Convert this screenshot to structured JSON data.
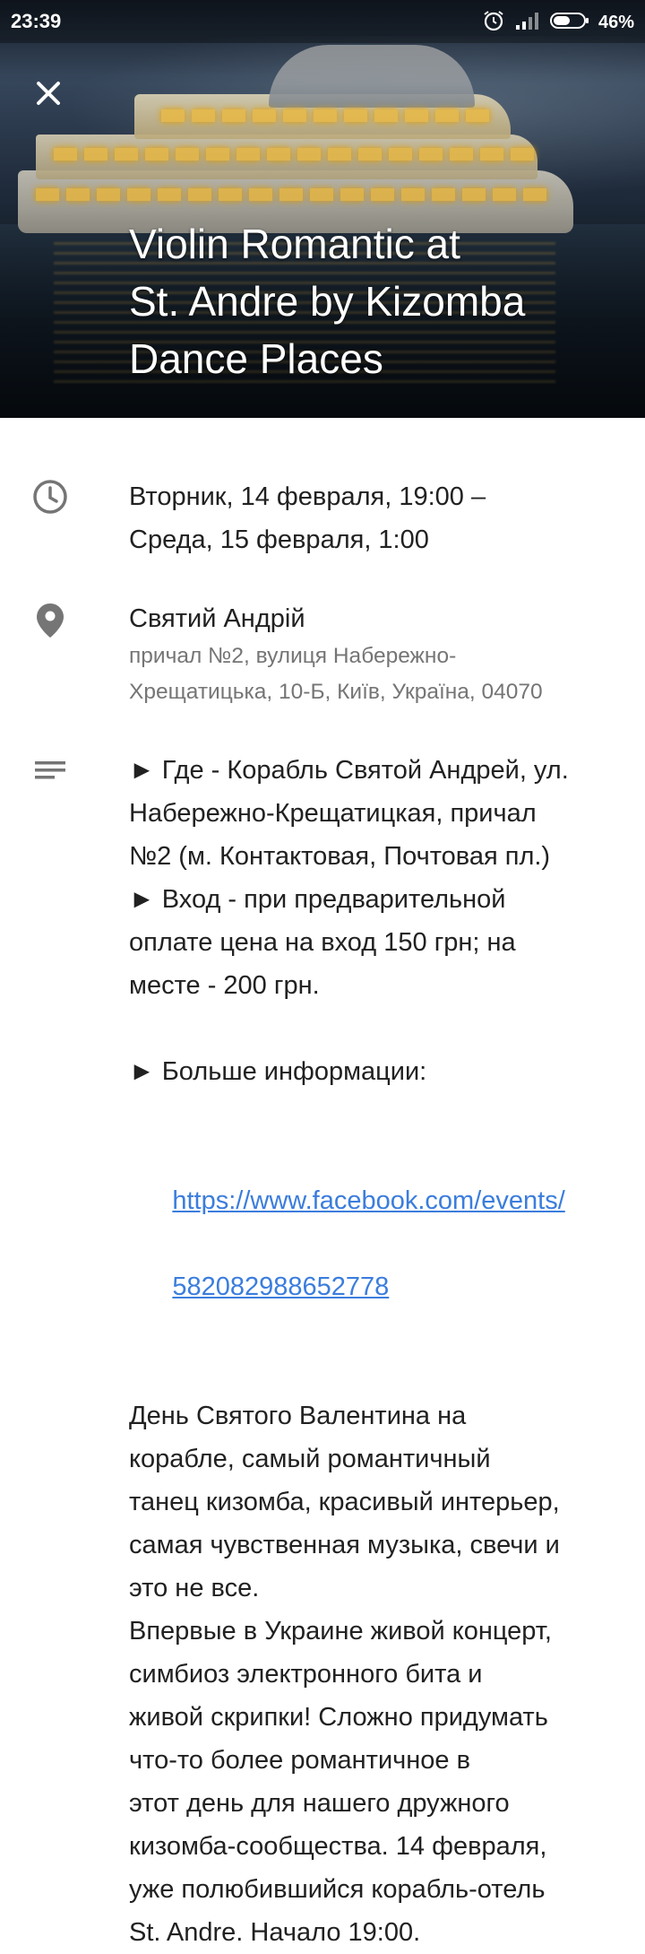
{
  "status_bar": {
    "time": "23:39",
    "battery_percent": "46%",
    "icons": [
      "alarm-icon",
      "signal-icon",
      "battery-icon"
    ]
  },
  "header": {
    "close_icon": "close-icon",
    "title_line1": "Violin Romantic at",
    "title_line2": "St. Andre by Kizomba",
    "title_line3": "Dance Places"
  },
  "time_row": {
    "icon": "clock-icon",
    "line1": "Вторник, 14 февраля, 19:00 –",
    "line2": "Среда, 15 февраля, 1:00"
  },
  "location_row": {
    "icon": "location-pin-icon",
    "name": "Святий Андрій",
    "address_line1": "причал №2, вулиця Набережно-",
    "address_line2": "Хрещатицька, 10-Б, Київ, Україна, 04070"
  },
  "description_row": {
    "icon": "notes-icon",
    "lines": [
      "► Где - Корабль Святой Андрей, ул.",
      "Набережно-Крещатицкая, причал",
      "№2 (м. Контактовая, Почтовая пл.)",
      "► Вход - при предварительной",
      "оплате цена на вход 150 грн; на",
      "месте - 200 грн.",
      "",
      "► Больше информации:",
      ""
    ],
    "link_line1": "https://www.facebook.com/events/",
    "link_line2": "582082988652778",
    "lines_after": [
      "",
      "День Святого Валентина на",
      "корабле, самый романтичный",
      "танец кизомба, красивый интерьер,",
      "самая чувственная музыка, свечи и",
      "это не все.",
      "Впервые в Украине живой концерт,",
      "симбиоз электронного бита и",
      "живой скрипки! Сложно придумать",
      "что-то более романтичное в",
      "этот день для нашего дружного",
      "кизомба-сообщества. 14 февраля,",
      "уже полюбившийся корабль-отель",
      "St. Andre. Начало 19:00."
    ]
  },
  "colors": {
    "link": "#3b7ddd",
    "icon_gray": "#757575",
    "secondary_text": "#757575"
  }
}
